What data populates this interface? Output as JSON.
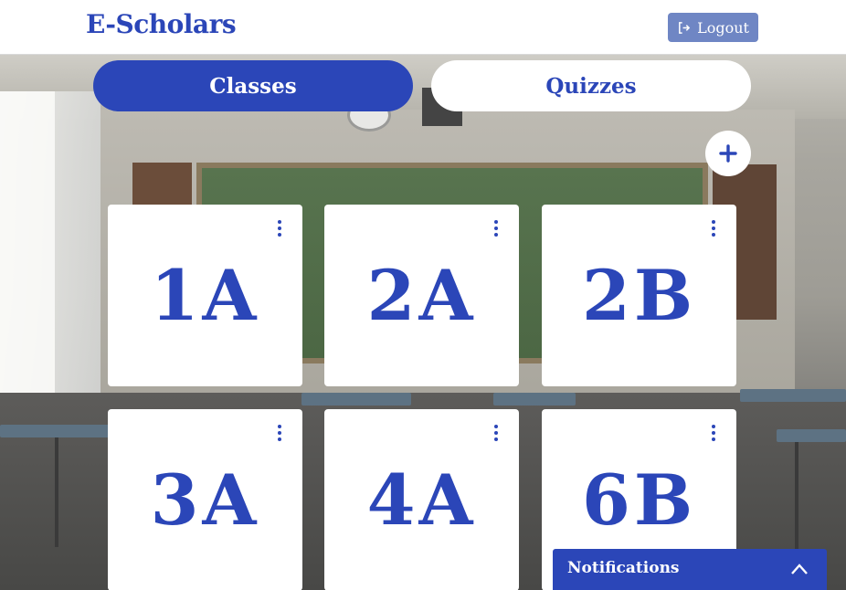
{
  "header": {
    "brand": "E-Scholars",
    "logout_label": "Logout"
  },
  "tabs": [
    {
      "label": "Classes",
      "active": true
    },
    {
      "label": "Quizzes",
      "active": false
    }
  ],
  "add_button": {
    "icon": "plus-icon"
  },
  "classes": [
    {
      "name": "1A"
    },
    {
      "name": "2A"
    },
    {
      "name": "2B"
    },
    {
      "name": "3A"
    },
    {
      "name": "4A"
    },
    {
      "name": "6B"
    }
  ],
  "notifications": {
    "title": "Notifications",
    "icon": "chevron-up-icon"
  },
  "colors": {
    "primary": "#2b46b8",
    "logout_bg": "#6f86c4",
    "card_bg": "#ffffff"
  }
}
